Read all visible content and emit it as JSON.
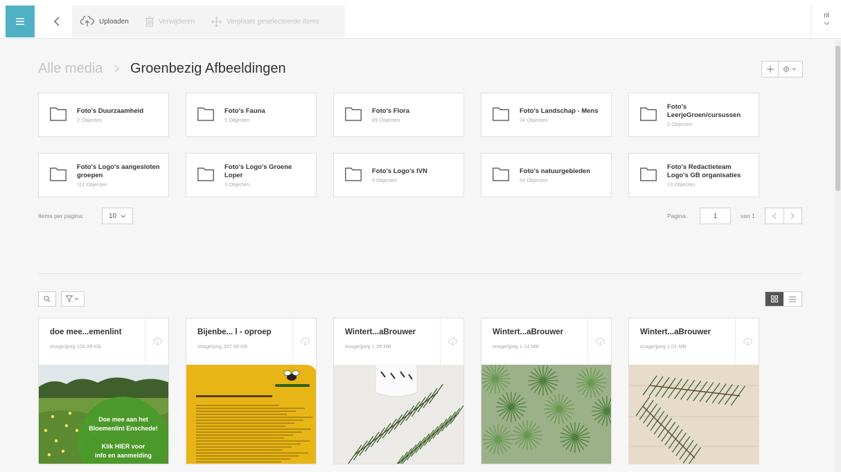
{
  "toolbar": {
    "upload_label": "Uploaden",
    "delete_label": "Verwijderen",
    "move_label": "Verplaats geselecteerde items",
    "language": "nl"
  },
  "breadcrumb": {
    "root": "Alle media",
    "current": "Groenbezig Afbeeldingen"
  },
  "folders": [
    {
      "name": "Foto's Duurzaamheid",
      "count": "2 Objecten"
    },
    {
      "name": "Foto's Fauna",
      "count": "5 Objecten"
    },
    {
      "name": "Foto's Flora",
      "count": "89 Objecten"
    },
    {
      "name": "Foto's Landschap - Mens",
      "count": "24 Objecten"
    },
    {
      "name": "Foto's LeerjeGroen/cursussen",
      "count": "2 Objecten"
    },
    {
      "name": "Foto's Logo's aangesloten groepen",
      "count": "111 Objecten"
    },
    {
      "name": "Foto's Logo's Groene Loper",
      "count": "3 Objecten"
    },
    {
      "name": "Foto's Logo's IVN",
      "count": "6 Objecten"
    },
    {
      "name": "Foto's natuurgebieden",
      "count": "53 Objecten"
    },
    {
      "name": "Foto's Redactieteam Logo's GB organisaties",
      "count": "13 Objecten"
    }
  ],
  "pagination": {
    "items_per_page_label": "Items per pagina:",
    "items_per_page": "10",
    "page_label": "Pagina:",
    "page": "1",
    "of_label": "van 1"
  },
  "media": [
    {
      "title": "doe mee...emenlint",
      "meta": "image/jpeg 124.99 KB",
      "thumb": "meadow-promo",
      "overlay_lines": [
        "Doe mee aan het",
        "Bloemenlint Enschede!",
        "",
        "Klik HIER voor",
        "info en aanmelding"
      ]
    },
    {
      "title": "Bijenbe... l - oproep",
      "meta": "image/png 297.59 KB",
      "thumb": "bee-flyer"
    },
    {
      "title": "Wintert...aBrouwer",
      "meta": "image/jpeg 1.35 MB",
      "thumb": "pine-mug"
    },
    {
      "title": "Wintert...aBrouwer",
      "meta": "image/jpeg 1.14 MB",
      "thumb": "pine-tree"
    },
    {
      "title": "Wintert...aBrouwer",
      "meta": "image/jpeg 1.01 MB",
      "thumb": "pine-twig"
    }
  ],
  "colors": {
    "accent": "#4fb0c6",
    "background": "#f6f6f6",
    "flyer_yellow": "#e7b515",
    "promo_green": "#4a9a2a"
  }
}
